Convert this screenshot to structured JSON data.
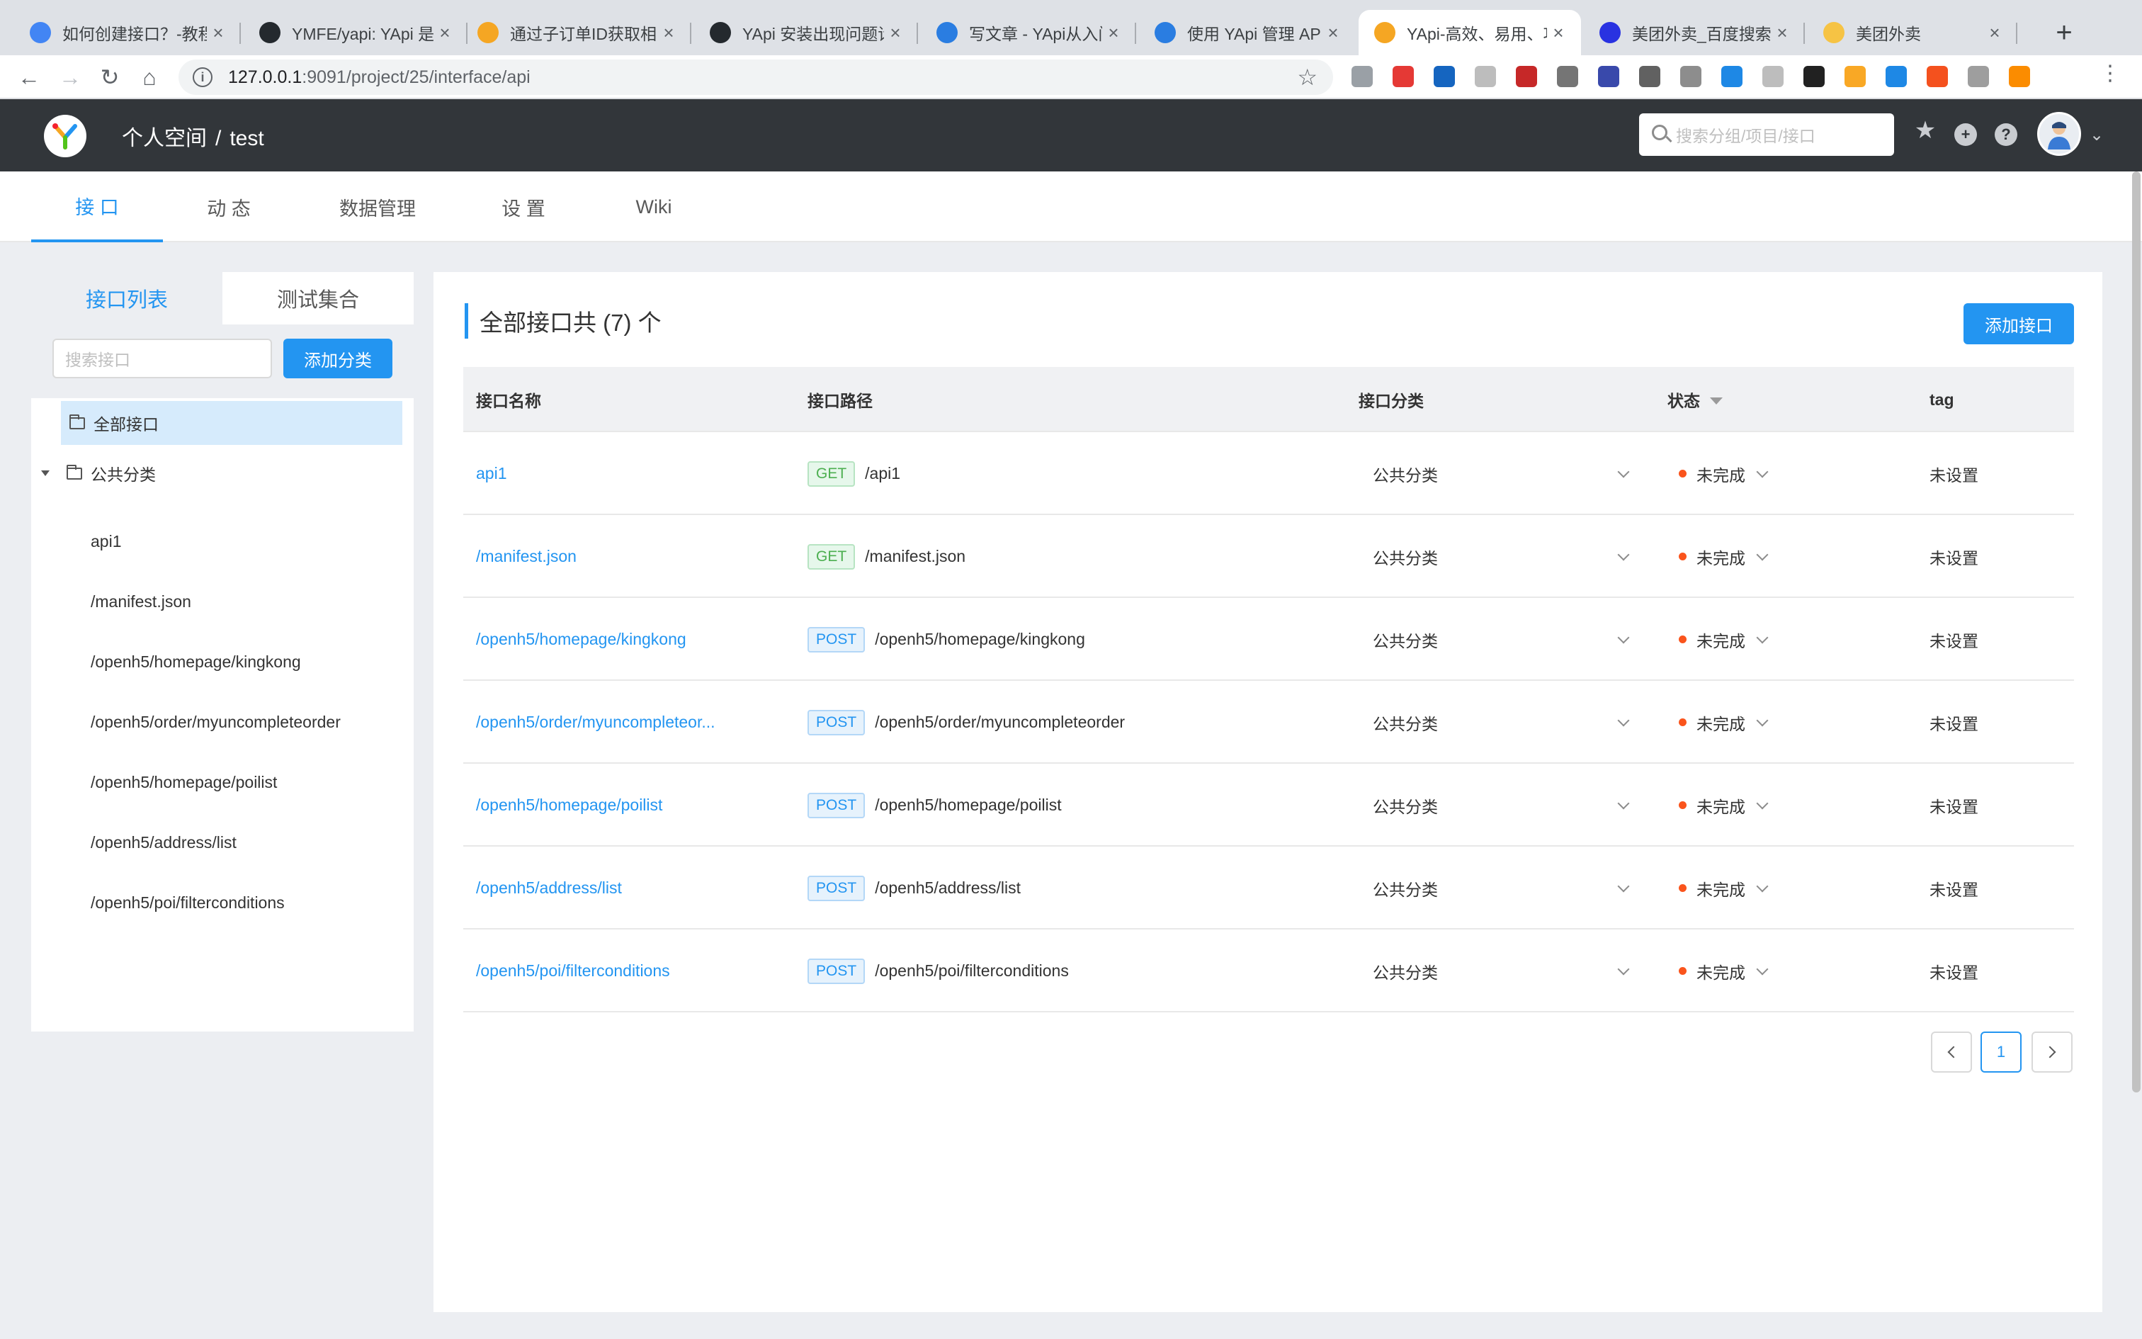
{
  "browser": {
    "tabs": [
      {
        "title": "如何创建接口？-教程",
        "icon": "tab-favicon-globe",
        "color": "#4285f4"
      },
      {
        "title": "YMFE/yapi: YApi 是",
        "icon": "github-icon",
        "color": "#24292e"
      },
      {
        "title": "通过子订单ID获取相",
        "icon": "yapi-icon",
        "color": "#f5a623"
      },
      {
        "title": "YApi 安装出现问题请",
        "icon": "github-icon",
        "color": "#24292e"
      },
      {
        "title": "写文章 - YApi从入门",
        "icon": "zhihu-icon",
        "color": "#2a7de1"
      },
      {
        "title": "使用 YApi 管理 API",
        "icon": "zhihu-icon",
        "color": "#2a7de1"
      },
      {
        "title": "YApi-高效、易用、功",
        "icon": "yapi-icon",
        "color": "#f5a623"
      },
      {
        "title": "美团外卖_百度搜索",
        "icon": "baidu-icon",
        "color": "#2932e1"
      },
      {
        "title": "美团外卖",
        "icon": "meituan-icon",
        "color": "#f6c344"
      }
    ],
    "url_host": "127.0.0.1",
    "url_path": ":9091/project/25/interface/api"
  },
  "header": {
    "crumb_space": "个人空间",
    "crumb_sep": "/",
    "crumb_project": "test",
    "search_placeholder": "搜索分组/项目/接口"
  },
  "subnav": [
    "接 口",
    "动 态",
    "数据管理",
    "设 置",
    "Wiki"
  ],
  "left": {
    "tab_list": "接口列表",
    "tab_collection": "测试集合",
    "search_placeholder": "搜索接口",
    "add_category": "添加分类",
    "all_label": "全部接口",
    "category": "公共分类",
    "items": [
      "api1",
      "/manifest.json",
      "/openh5/homepage/kingkong",
      "/openh5/order/myuncompleteorder",
      "/openh5/homepage/poilist",
      "/openh5/address/list",
      "/openh5/poi/filterconditions"
    ]
  },
  "main": {
    "title": "全部接口共 (7) 个",
    "add_button": "添加接口",
    "columns": {
      "name": "接口名称",
      "path": "接口路径",
      "category": "接口分类",
      "status": "状态",
      "tag": "tag"
    },
    "rows": [
      {
        "name": "api1",
        "method": "GET",
        "path": "/api1",
        "category": "公共分类",
        "status": "未完成",
        "tag": "未设置"
      },
      {
        "name": "/manifest.json",
        "method": "GET",
        "path": "/manifest.json",
        "category": "公共分类",
        "status": "未完成",
        "tag": "未设置"
      },
      {
        "name": "/openh5/homepage/kingkong",
        "method": "POST",
        "path": "/openh5/homepage/kingkong",
        "category": "公共分类",
        "status": "未完成",
        "tag": "未设置"
      },
      {
        "name": "/openh5/order/myuncompleteor...",
        "method": "POST",
        "path": "/openh5/order/myuncompleteorder",
        "category": "公共分类",
        "status": "未完成",
        "tag": "未设置"
      },
      {
        "name": "/openh5/homepage/poilist",
        "method": "POST",
        "path": "/openh5/homepage/poilist",
        "category": "公共分类",
        "status": "未完成",
        "tag": "未设置"
      },
      {
        "name": "/openh5/address/list",
        "method": "POST",
        "path": "/openh5/address/list",
        "category": "公共分类",
        "status": "未完成",
        "tag": "未设置"
      },
      {
        "name": "/openh5/poi/filterconditions",
        "method": "POST",
        "path": "/openh5/poi/filterconditions",
        "category": "公共分类",
        "status": "未完成",
        "tag": "未设置"
      }
    ],
    "page": "1"
  },
  "colors": {
    "accent": "#2395f1",
    "header_bg": "#32363a",
    "status_dot": "#fa541c"
  }
}
